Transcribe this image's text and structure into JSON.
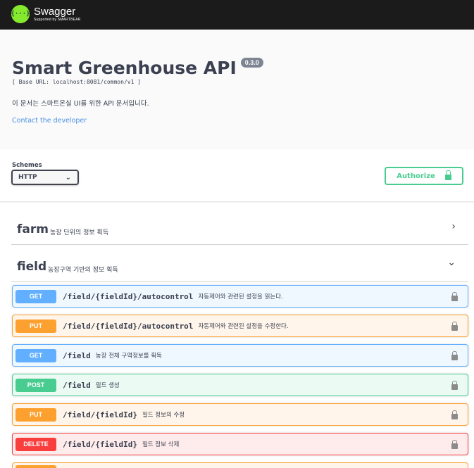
{
  "topbar": {
    "logo_icon": "{···}",
    "logo_title": "Swagger",
    "logo_subtitle": "Supported by SMARTBEAR"
  },
  "info": {
    "title": "Smart Greenhouse API",
    "version": "0.3.0",
    "base_url": "[ Base URL: localhost:8081/common/v1 ]",
    "description": "이 문서는 스마트온실 UI를 위한 API 문서입니다.",
    "contact_link": "Contact the developer"
  },
  "schemes": {
    "label": "Schemes",
    "selected": "HTTP",
    "authorize_label": "Authorize"
  },
  "tags": [
    {
      "name": "farm",
      "description": "농장 단위의 정보 획득",
      "expanded": false,
      "arrow": "›"
    },
    {
      "name": "field",
      "description": "농장구역 기반의 정보 획득",
      "expanded": true,
      "arrow": "⌄"
    }
  ],
  "operations": [
    {
      "method": "GET",
      "path": "/field/{fieldId}/autocontrol",
      "summary": "자동제어와 관련된 설정을 읽는다."
    },
    {
      "method": "PUT",
      "path": "/field/{fieldId}/autocontrol",
      "summary": "자동제어와 관련된 설정을 수정한다."
    },
    {
      "method": "GET",
      "path": "/field",
      "summary": "농장 전체 구역정보를 획득"
    },
    {
      "method": "POST",
      "path": "/field",
      "summary": "필드 생성"
    },
    {
      "method": "PUT",
      "path": "/field/{fieldId}",
      "summary": "필드 정보의 수정"
    },
    {
      "method": "DELETE",
      "path": "/field/{fieldId}",
      "summary": "필드 정보 삭제"
    }
  ],
  "colors": {
    "get": "#61affe",
    "put": "#fca130",
    "post": "#49cc90",
    "delete": "#f93e3e",
    "topbar": "#1b1b1b",
    "logo_green": "#85ea2d"
  }
}
